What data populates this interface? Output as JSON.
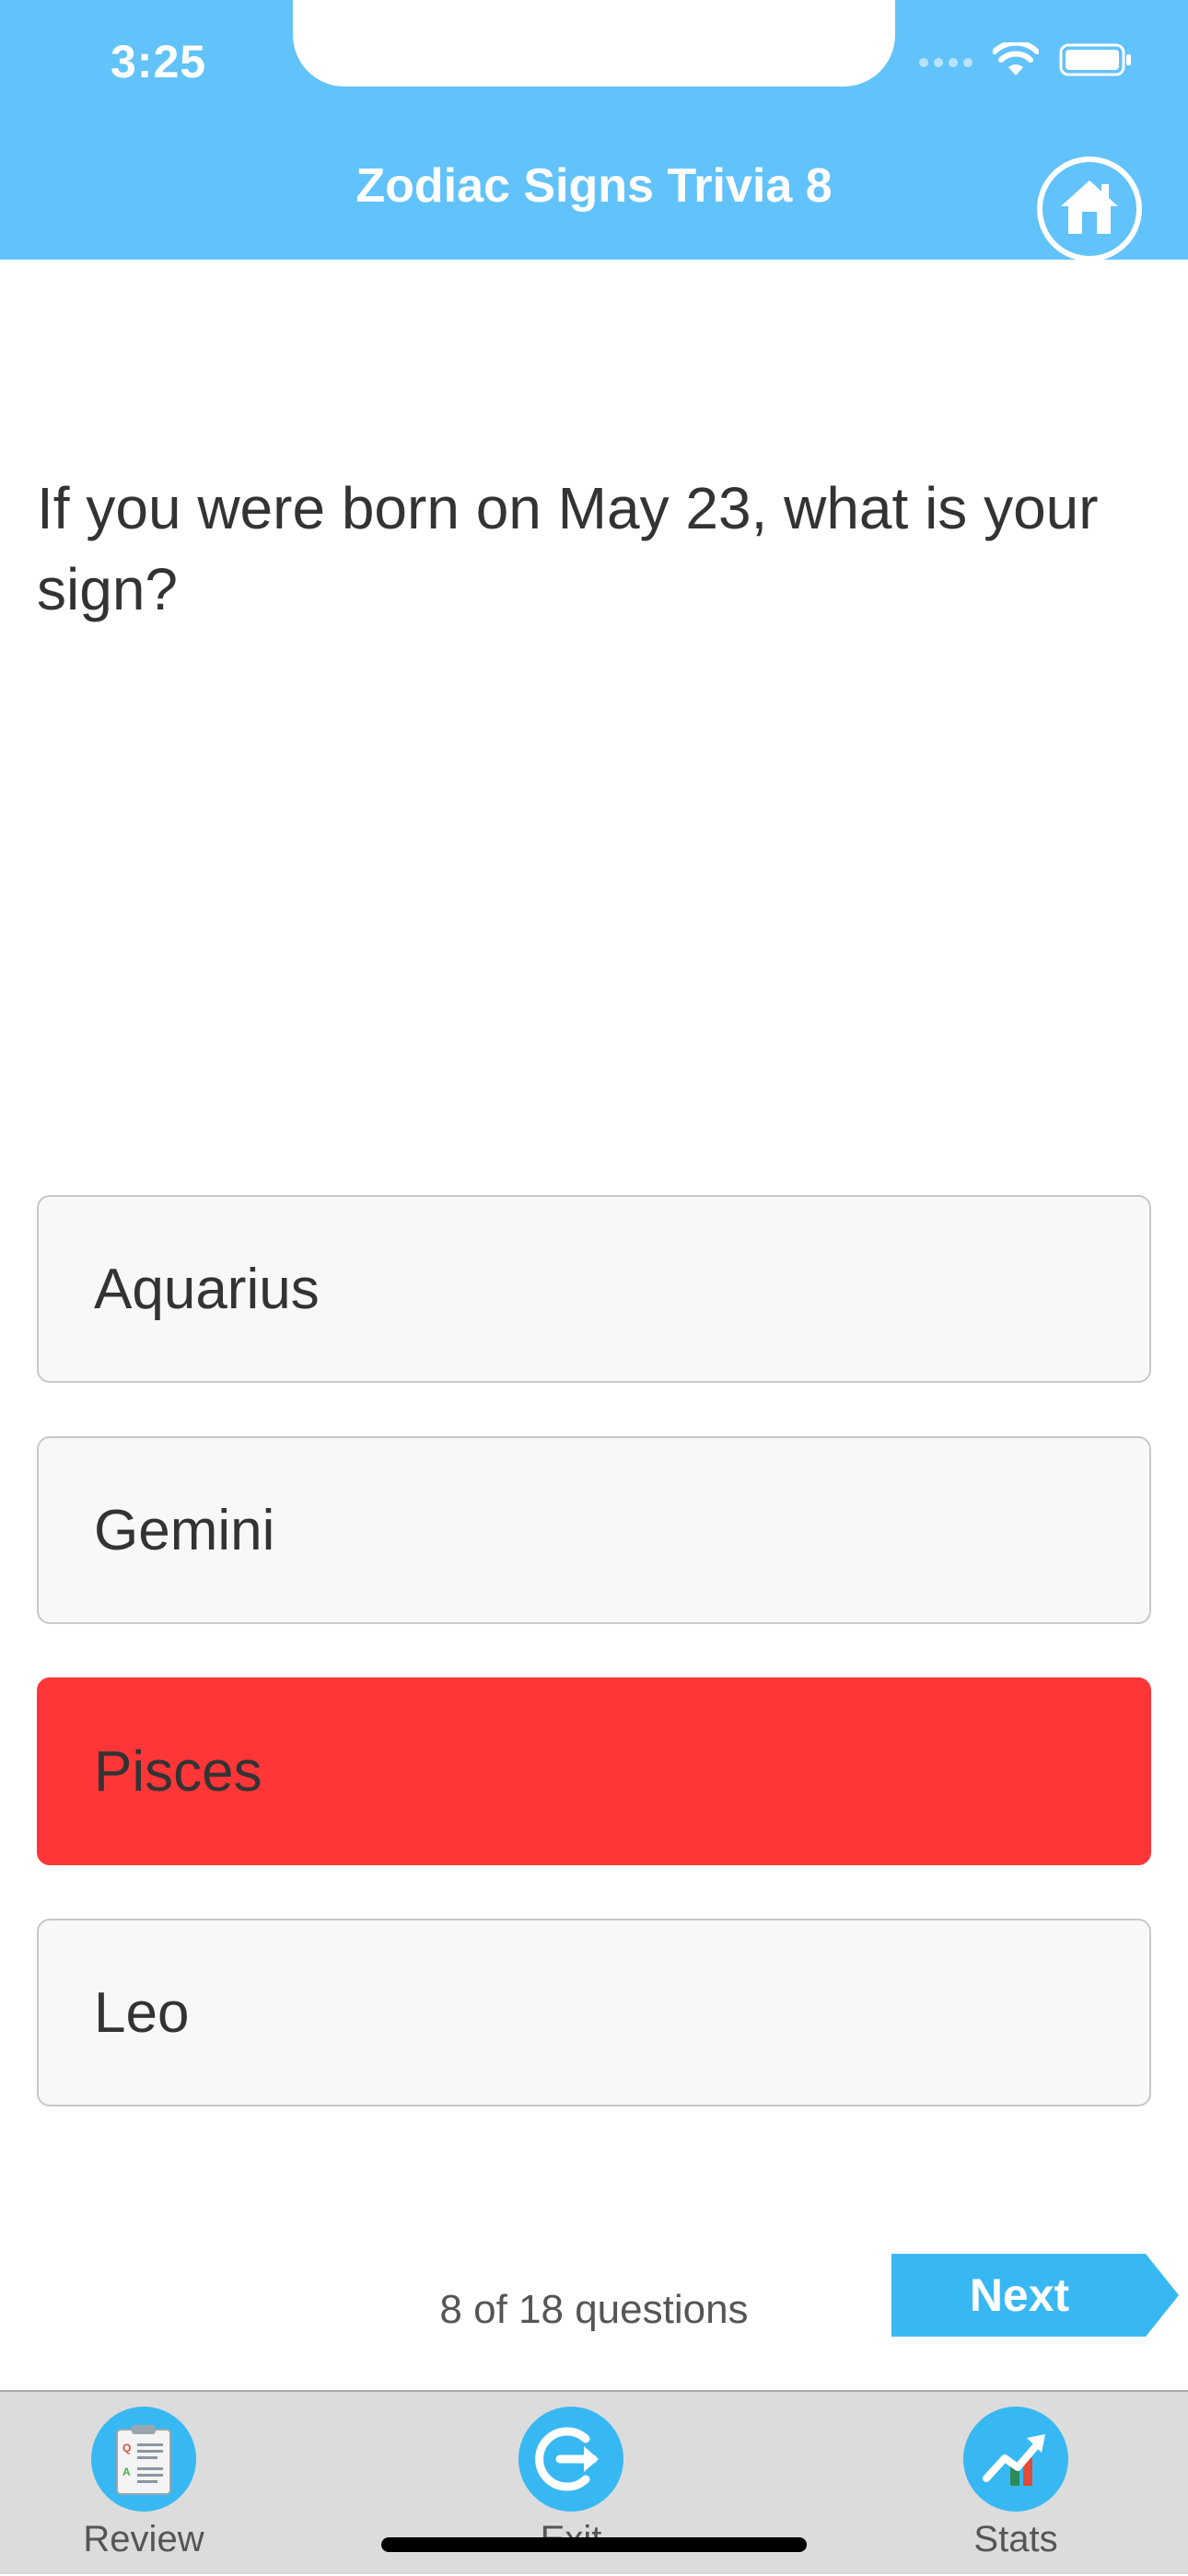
{
  "status_bar": {
    "time": "3:25"
  },
  "header": {
    "title": "Zodiac Signs Trivia 8",
    "home_icon": "home-icon",
    "background_color": "#62c2fa"
  },
  "question": {
    "text": "If you were born on May 23, what is your sign?"
  },
  "answers": [
    {
      "label": "Aquarius",
      "state": "default"
    },
    {
      "label": "Gemini",
      "state": "default"
    },
    {
      "label": "Pisces",
      "state": "wrong"
    },
    {
      "label": "Leo",
      "state": "default"
    }
  ],
  "colors": {
    "wrong_answer": "#fe3638",
    "accent": "#38b8f2"
  },
  "progress": {
    "text": "8 of 18 questions",
    "current": 8,
    "total": 18
  },
  "next_button": {
    "label": "Next"
  },
  "tabbar": {
    "items": [
      {
        "label": "Review",
        "icon": "review-clipboard-icon"
      },
      {
        "label": "Exit",
        "icon": "exit-icon"
      },
      {
        "label": "Stats",
        "icon": "stats-chart-icon"
      }
    ]
  }
}
